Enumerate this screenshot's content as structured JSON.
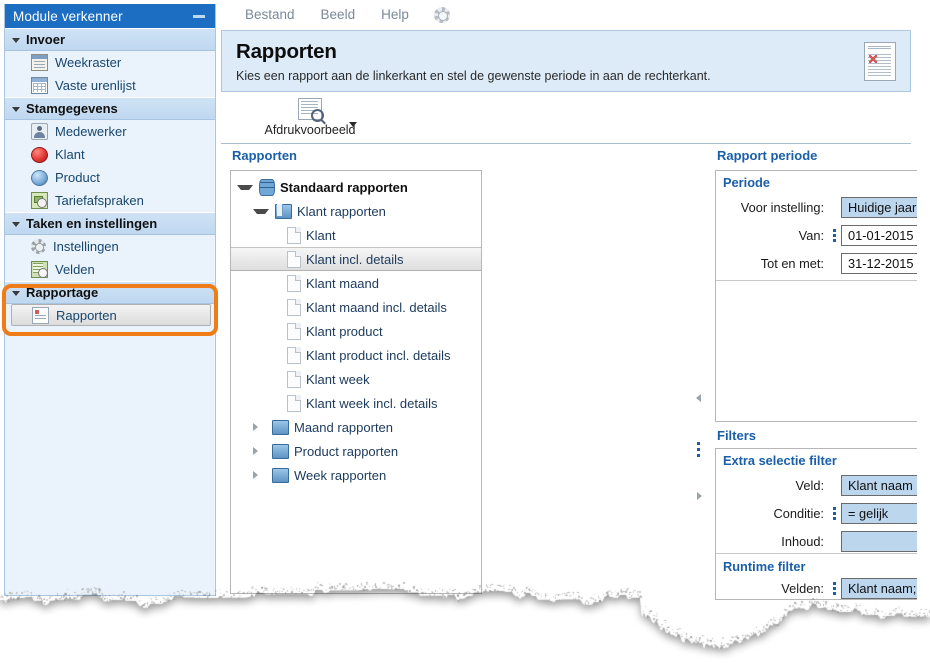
{
  "sidebar": {
    "header_title": "Module verkenner",
    "minimize_label": "–",
    "groups": [
      {
        "label": "Invoer",
        "items": [
          {
            "label": "Weekraster",
            "icon": "calendar-icon"
          },
          {
            "label": "Vaste urenlijst",
            "icon": "grid-icon"
          }
        ]
      },
      {
        "label": "Stamgegevens",
        "items": [
          {
            "label": "Medewerker",
            "icon": "person-icon"
          },
          {
            "label": "Klant",
            "icon": "red-sphere-icon"
          },
          {
            "label": "Product",
            "icon": "blue-sphere-icon"
          },
          {
            "label": "Tariefafspraken",
            "icon": "rate-icon"
          }
        ]
      },
      {
        "label": "Taken en instellingen",
        "items": [
          {
            "label": "Instellingen",
            "icon": "gear-icon"
          },
          {
            "label": "Velden",
            "icon": "fields-icon"
          }
        ]
      },
      {
        "label": "Rapportage",
        "items": [
          {
            "label": "Rapporten",
            "icon": "report-icon",
            "selected": true
          }
        ]
      }
    ],
    "highlight_color": "#f07c17"
  },
  "menubar": {
    "items": [
      "Bestand",
      "Beeld",
      "Help"
    ],
    "gear_icon": "gear-icon"
  },
  "banner": {
    "title": "Rapporten",
    "subtitle": "Kies een rapport aan de linkerkant en stel de gewenste periode in aan de rechterkant.",
    "icon": "report-document-icon"
  },
  "toolbar": {
    "preview_label": "Afdrukvoorbeeld",
    "preview_icon": "print-preview-icon",
    "dropdown_icon": "caret-down-icon"
  },
  "reports_pane": {
    "caption": "Rapporten",
    "tree": [
      {
        "label": "Standaard rapporten",
        "level": 0,
        "expander": "open",
        "icon": "database-icon",
        "selected": false
      },
      {
        "label": "Klant rapporten",
        "level": 1,
        "expander": "open",
        "icon": "folder-open-icon",
        "selected": false
      },
      {
        "label": "Klant",
        "level": 2,
        "expander": "none",
        "icon": "page-icon",
        "selected": false
      },
      {
        "label": "Klant incl. details",
        "level": 2,
        "expander": "none",
        "icon": "page-icon",
        "selected": true
      },
      {
        "label": "Klant maand",
        "level": 2,
        "expander": "none",
        "icon": "page-icon",
        "selected": false
      },
      {
        "label": "Klant maand incl. details",
        "level": 2,
        "expander": "none",
        "icon": "page-icon",
        "selected": false
      },
      {
        "label": "Klant product",
        "level": 2,
        "expander": "none",
        "icon": "page-icon",
        "selected": false
      },
      {
        "label": "Klant product incl. details",
        "level": 2,
        "expander": "none",
        "icon": "page-icon",
        "selected": false
      },
      {
        "label": "Klant week",
        "level": 2,
        "expander": "none",
        "icon": "page-icon",
        "selected": false
      },
      {
        "label": "Klant week incl. details",
        "level": 2,
        "expander": "none",
        "icon": "page-icon",
        "selected": false
      },
      {
        "label": "Maand rapporten",
        "level": 1,
        "expander": "closed",
        "icon": "folder-icon",
        "selected": false
      },
      {
        "label": "Product rapporten",
        "level": 1,
        "expander": "closed",
        "icon": "folder-icon",
        "selected": false
      },
      {
        "label": "Week rapporten",
        "level": 1,
        "expander": "closed",
        "icon": "folder-icon",
        "selected": false
      }
    ]
  },
  "period_pane": {
    "caption": "Rapport periode",
    "section_title": "Periode",
    "fields": [
      {
        "label": "Voor instelling:",
        "value": "Huidige jaar",
        "style": "blue",
        "dots": false
      },
      {
        "label": "Van:",
        "value": "01-01-2015",
        "style": "white",
        "dots": true
      },
      {
        "label": "Tot en met:",
        "value": "31-12-2015",
        "style": "white",
        "dots": false
      }
    ]
  },
  "filters_pane": {
    "caption": "Filters",
    "extra_section_title": "Extra selectie filter",
    "extra_fields": [
      {
        "label": "Veld:",
        "value": "Klant naam",
        "style": "blue",
        "dots": false
      },
      {
        "label": "Conditie:",
        "value": "= gelijk",
        "style": "blue",
        "dots": true
      }
    ],
    "content_label": "Inhoud:",
    "content_value": "",
    "content_browse_label": "...",
    "runtime_section_title": "Runtime filter",
    "runtime_label": "Velden:",
    "runtime_value": "Klant naam; Uren datum"
  },
  "splitter": {
    "collapse_left_icon": "triangle-left-icon",
    "grip_icon": "grip-dots-icon",
    "collapse_right_icon": "triangle-right-icon"
  }
}
